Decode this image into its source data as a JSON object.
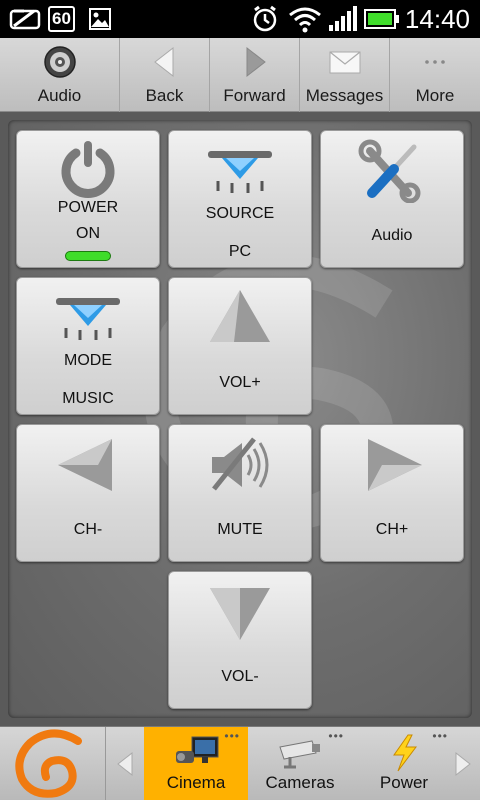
{
  "status_bar": {
    "notification_count": "60",
    "time": "14:40"
  },
  "action_bar": {
    "items": [
      {
        "label": "Audio",
        "icon": "speaker-icon"
      },
      {
        "label": "Back",
        "icon": "back-arrow-icon"
      },
      {
        "label": "Forward",
        "icon": "forward-arrow-icon"
      },
      {
        "label": "Messages",
        "icon": "envelope-icon"
      },
      {
        "label": "More",
        "icon": "more-dots-icon"
      }
    ]
  },
  "remote": {
    "power": {
      "label": "POWER",
      "state": "ON"
    },
    "source": {
      "label": "SOURCE",
      "value": "PC"
    },
    "audio": {
      "label": "Audio"
    },
    "mode": {
      "label": "MODE",
      "value": "MUSIC"
    },
    "vol_up": {
      "label": "VOL+"
    },
    "ch_down": {
      "label": "CH-"
    },
    "mute": {
      "label": "MUTE"
    },
    "ch_up": {
      "label": "CH+"
    },
    "vol_down": {
      "label": "VOL-"
    }
  },
  "bottom_bar": {
    "categories": [
      {
        "label": "Cinema",
        "icon": "tv-projector-icon",
        "more": "•••",
        "active": true
      },
      {
        "label": "Cameras",
        "icon": "security-camera-icon",
        "more": "•••",
        "active": false
      },
      {
        "label": "Power",
        "icon": "lightning-icon",
        "more": "•••",
        "active": false
      }
    ]
  },
  "colors": {
    "accent": "#ffb100",
    "led_on": "#3fdc2a",
    "tile_blue": "#2e9be6"
  }
}
